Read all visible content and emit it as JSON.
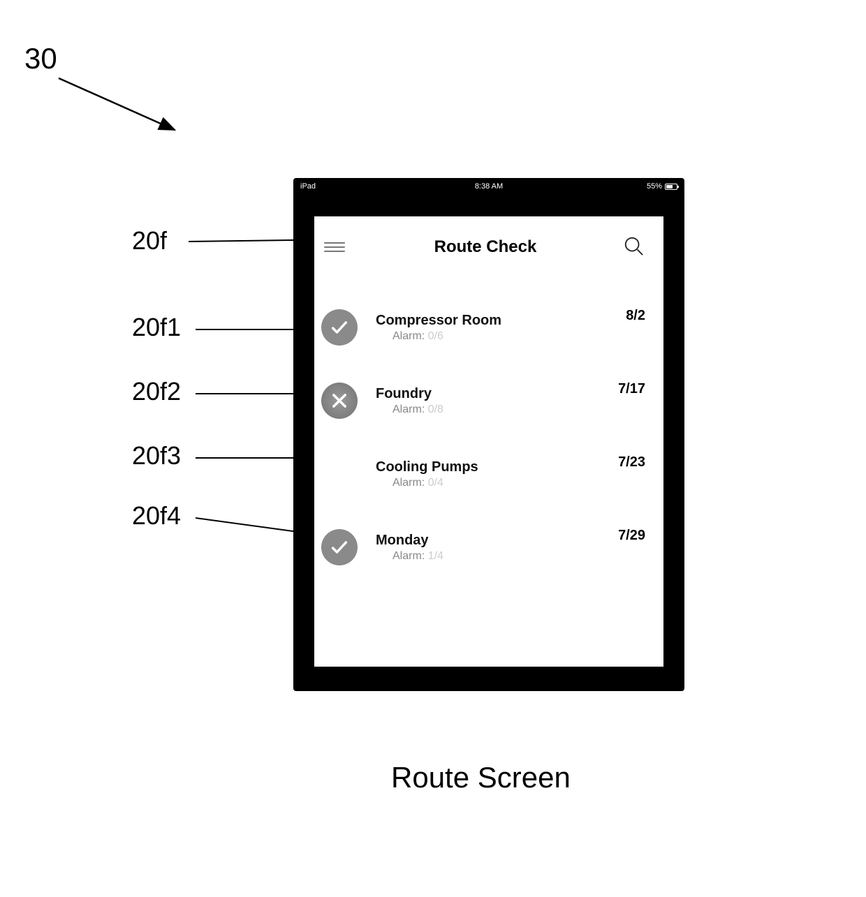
{
  "figure_number": "30",
  "caption": "Route Screen",
  "status_bar": {
    "left": "iPad",
    "time": "8:38 AM",
    "battery_pct": "55%"
  },
  "header": {
    "title": "Route Check"
  },
  "routes": [
    {
      "name": "Compressor Room",
      "alarm_label": "Alarm:",
      "alarm_value": "0/6",
      "date": "8/2",
      "status": "check"
    },
    {
      "name": "Foundry",
      "alarm_label": "Alarm:",
      "alarm_value": "0/8",
      "date": "7/17",
      "status": "cross"
    },
    {
      "name": "Cooling Pumps",
      "alarm_label": "Alarm:",
      "alarm_value": "0/4",
      "date": "7/23",
      "status": "none"
    },
    {
      "name": "Monday",
      "alarm_label": "Alarm:",
      "alarm_value": "1/4",
      "date": "7/29",
      "status": "check"
    }
  ],
  "callouts": {
    "c0": "20f",
    "c1": "20f1",
    "c2": "20f2",
    "c3": "20f3",
    "c4": "20f4"
  }
}
